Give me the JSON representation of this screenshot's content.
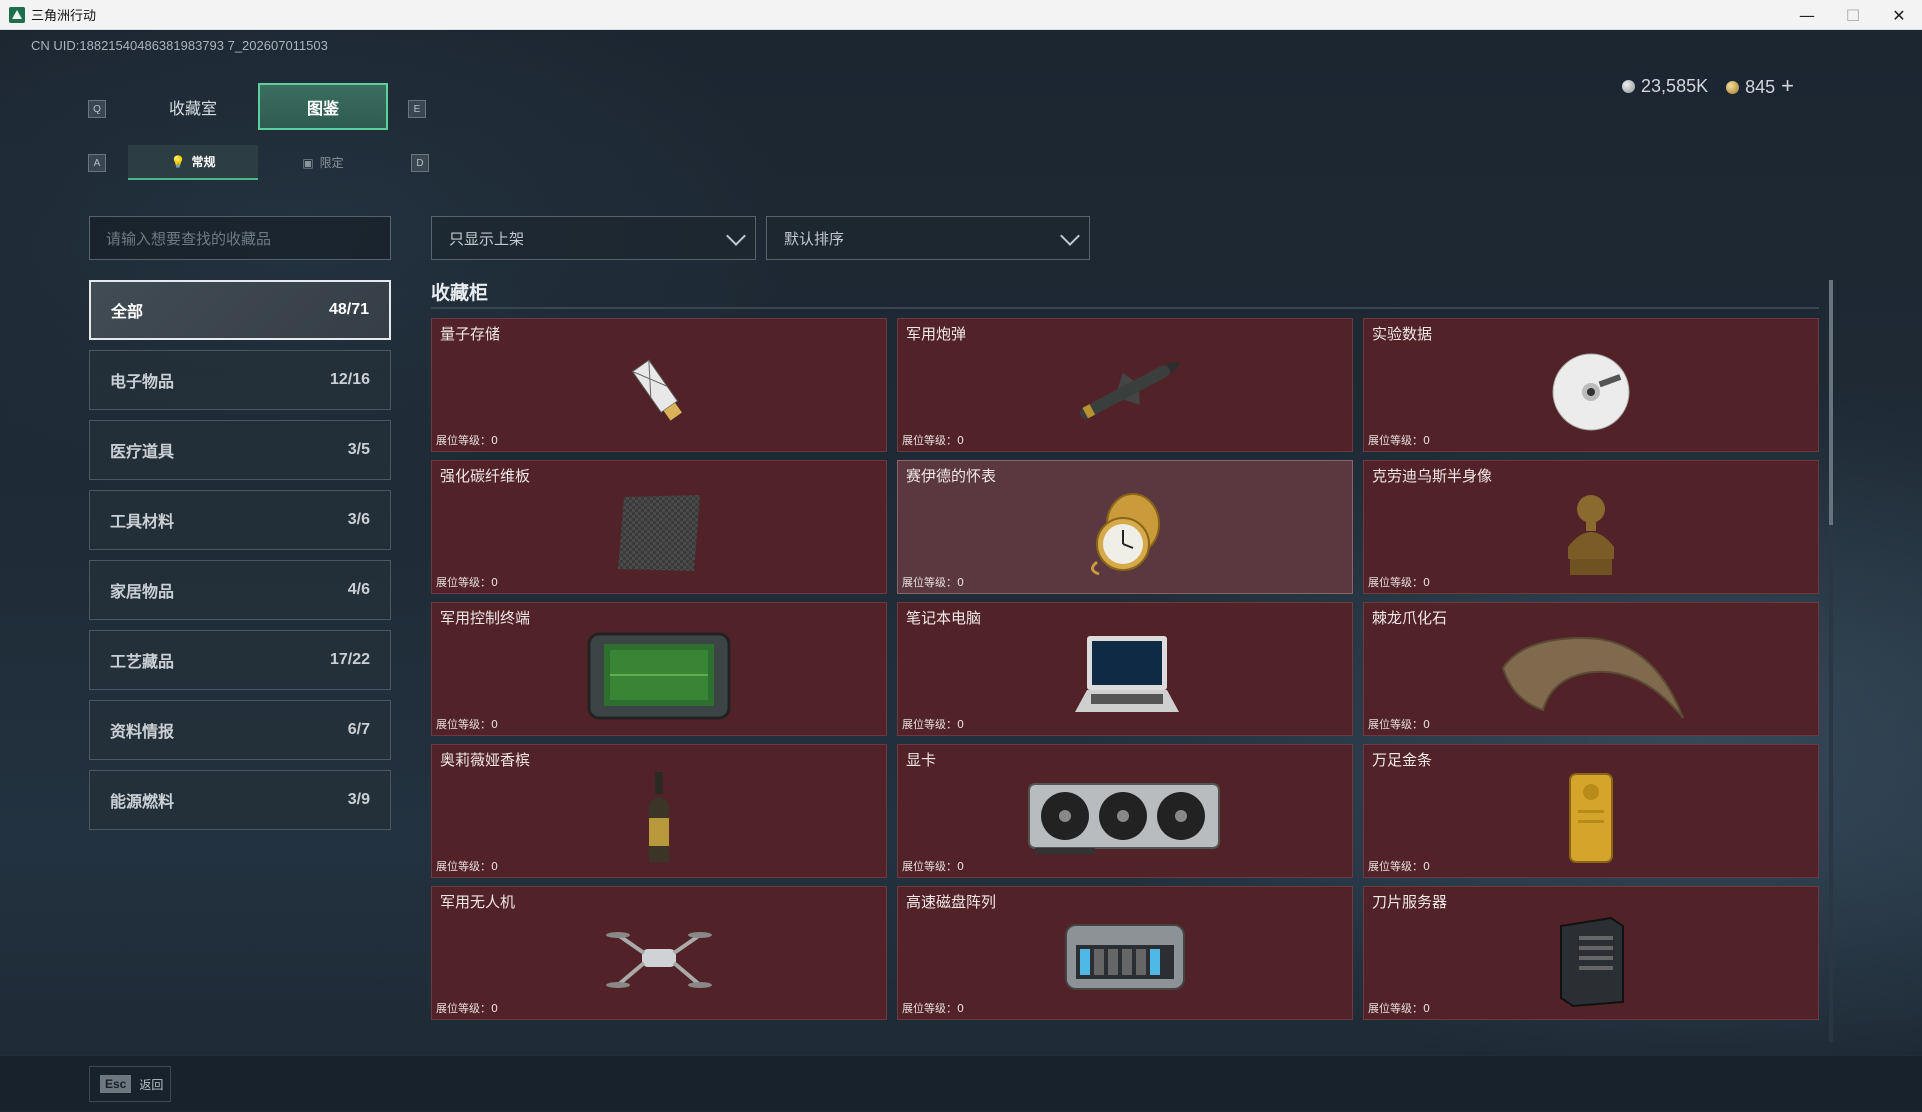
{
  "window": {
    "title": "三角洲行动"
  },
  "uid": "CN UID:18821540486381983793 7_202607011503",
  "currency": {
    "silver": "23,585K",
    "gold": "845",
    "add": "+"
  },
  "keys": {
    "prev_tab": "Q",
    "next_tab": "E",
    "prev_sub": "A",
    "next_sub": "D"
  },
  "tabs": [
    {
      "label": "收藏室"
    },
    {
      "label": "图鉴"
    }
  ],
  "subtabs": [
    {
      "label": "常规"
    },
    {
      "label": "限定"
    }
  ],
  "search": {
    "placeholder": "请输入想要查找的收藏品"
  },
  "filters": {
    "display": "只显示上架",
    "sort": "默认排序"
  },
  "categories": [
    {
      "name": "全部",
      "count": "48/71"
    },
    {
      "name": "电子物品",
      "count": "12/16"
    },
    {
      "name": "医疗道具",
      "count": "3/5"
    },
    {
      "name": "工具材料",
      "count": "3/6"
    },
    {
      "name": "家居物品",
      "count": "4/6"
    },
    {
      "name": "工艺藏品",
      "count": "17/22"
    },
    {
      "name": "资料情报",
      "count": "6/7"
    },
    {
      "name": "能源燃料",
      "count": "3/9"
    }
  ],
  "section": {
    "title": "收藏柜"
  },
  "items": [
    {
      "name": "量子存储",
      "level": "展位等级：0"
    },
    {
      "name": "军用炮弹",
      "level": "展位等级：0"
    },
    {
      "name": "实验数据",
      "level": "展位等级：0"
    },
    {
      "name": "强化碳纤维板",
      "level": "展位等级：0"
    },
    {
      "name": "赛伊德的怀表",
      "level": "展位等级：0"
    },
    {
      "name": "克劳迪乌斯半身像",
      "level": "展位等级：0"
    },
    {
      "name": "军用控制终端",
      "level": "展位等级：0"
    },
    {
      "name": "笔记本电脑",
      "level": "展位等级：0"
    },
    {
      "name": "棘龙爪化石",
      "level": "展位等级：0"
    },
    {
      "name": "奥莉薇娅香槟",
      "level": "展位等级：0"
    },
    {
      "name": "显卡",
      "level": "展位等级：0"
    },
    {
      "name": "万足金条",
      "level": "展位等级：0"
    },
    {
      "name": "军用无人机",
      "level": "展位等级：0"
    },
    {
      "name": "高速磁盘阵列",
      "level": "展位等级：0"
    },
    {
      "name": "刀片服务器",
      "level": "展位等级：0"
    }
  ],
  "footer": {
    "esc_key": "Esc",
    "back_label": "返回"
  }
}
